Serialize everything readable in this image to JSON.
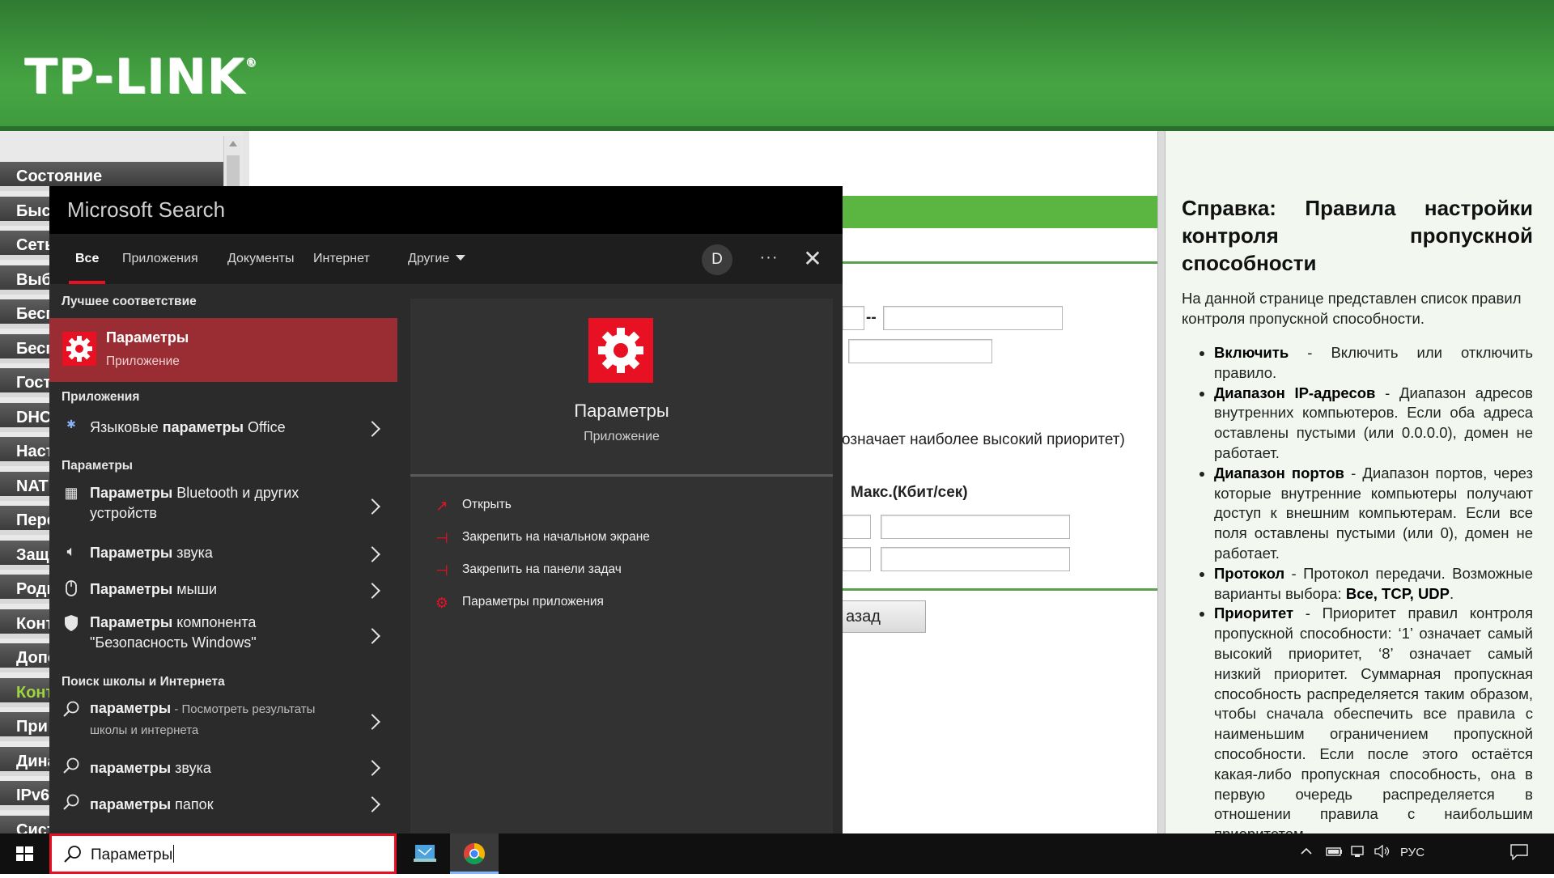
{
  "tplink": {
    "logo": "TP-LINK",
    "logo_mark": "®",
    "sidebar_items": [
      "Состояние",
      "Быс",
      "Сеть",
      "Выб",
      "Бесп",
      "Бесп",
      "Гост",
      "DHC",
      "Наст",
      "NAT",
      "Пере",
      "Защ",
      "Роди",
      "Конт",
      "Допо",
      "Конт",
      "При",
      "Дина",
      "IPv6",
      "Сист"
    ],
    "active_sidebar_index": 15,
    "priority_text": "означает наиболее высокий приоритет)",
    "max_label": "Макс.(Кбит/сек)",
    "dash": "--",
    "back_button": "азад",
    "help": {
      "title": "Справка: Правила настройки контроля пропускной способности",
      "intro": "На данной странице представлен список правил контроля пропускной способности.",
      "items": [
        {
          "term": "Включить",
          "text": " - Включить или отключить правило."
        },
        {
          "term": "Диапазон IP-адресов",
          "text": " - Диапазон адресов внутренних компьютеров. Если оба адреса оставлены пустыми (или 0.0.0.0), домен не работает."
        },
        {
          "term": "Диапазон портов",
          "text": " - Диапазон портов, через которые внутренние компьютеры получают доступ к внешним компьютерам. Если все поля оставлены пустыми (или 0), домен не работает."
        },
        {
          "term": "Протокол",
          "text": " - Протокол передачи. Возможные варианты выбора: ",
          "tail_bold": "Все, TCP, UDP",
          "tail": "."
        },
        {
          "term": "Приоритет",
          "text": " - Приоритет правил контроля пропускной способности: ‘1’ означает самый высокий приоритет, ‘8’ означает самый низкий приоритет. Суммарная пропускная способность распределяется таким образом, чтобы сначала обеспечить все правила с наименьшим ограничением пропускной способности. Если после этого остаётся какая-либо пропускная способность, она в первую очередь распределяется в отношении правила с наибольшим приоритетом"
        }
      ]
    }
  },
  "search": {
    "title": "Microsoft Search",
    "tabs": [
      "Все",
      "Приложения",
      "Документы",
      "Интернет",
      "Другие"
    ],
    "avatar": "D",
    "more": "···",
    "close": "✕",
    "best_match_header": "Лучшее соответствие",
    "best_match": {
      "title": "Параметры",
      "subtitle": "Приложение"
    },
    "apps_header": "Приложения",
    "apps": [
      {
        "icon": "language-settings-icon",
        "text": "Языковые ",
        "bold": "параметры",
        "rest": " Office"
      }
    ],
    "settings_header": "Параметры",
    "settings": [
      {
        "icon": "bluetooth-devices-icon",
        "bold": "Параметры",
        "rest": " Bluetooth и других устройств"
      },
      {
        "icon": "speaker-icon",
        "bold": "Параметры",
        "rest": " звука"
      },
      {
        "icon": "mouse-icon",
        "bold": "Параметры",
        "rest": " мыши"
      },
      {
        "icon": "shield-icon",
        "bold": "Параметры",
        "rest": " компонента \"Безопасность Windows\""
      }
    ],
    "web_header": "Поиск школы и Интернета",
    "web": [
      {
        "bold": "параметры",
        "muted": " - Посмотреть результаты школы и интернета"
      },
      {
        "bold": "параметры",
        "rest": " звука"
      },
      {
        "bold": "параметры",
        "rest": " папок"
      }
    ],
    "preview": {
      "title": "Параметры",
      "subtitle": "Приложение",
      "actions": [
        "Открыть",
        "Закрепить на начальном экране",
        "Закрепить на панели задач",
        "Параметры приложения"
      ]
    },
    "query": "Параметры"
  },
  "taskbar": {
    "lang": "РУС"
  },
  "colors": {
    "accent": "#e81123",
    "tplink_green": "#3e9a3d",
    "panel_bg": "#2b2b2b"
  }
}
